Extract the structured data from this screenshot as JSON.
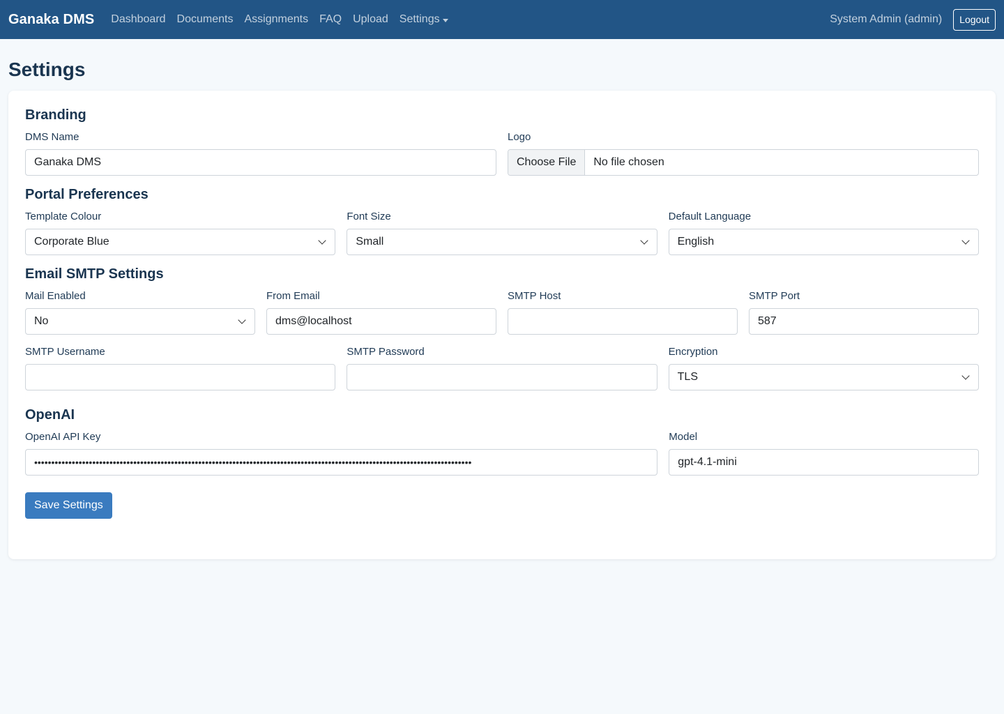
{
  "navbar": {
    "brand": "Ganaka DMS",
    "links": [
      "Dashboard",
      "Documents",
      "Assignments",
      "FAQ",
      "Upload"
    ],
    "settings_label": "Settings",
    "user": "System Admin (admin)",
    "logout": "Logout"
  },
  "page": {
    "title": "Settings"
  },
  "branding": {
    "title": "Branding",
    "dms_name_label": "DMS Name",
    "dms_name_value": "Ganaka DMS",
    "logo_label": "Logo",
    "choose_file": "Choose File",
    "no_file": "No file chosen"
  },
  "portal": {
    "title": "Portal Preferences",
    "template_label": "Template Colour",
    "template_value": "Corporate Blue",
    "font_label": "Font Size",
    "font_value": "Small",
    "lang_label": "Default Language",
    "lang_value": "English"
  },
  "smtp": {
    "title": "Email SMTP Settings",
    "mail_enabled_label": "Mail Enabled",
    "mail_enabled_value": "No",
    "from_label": "From Email",
    "from_value": "dms@localhost",
    "host_label": "SMTP Host",
    "host_value": "",
    "port_label": "SMTP Port",
    "port_value": "587",
    "username_label": "SMTP Username",
    "username_value": "",
    "password_label": "SMTP Password",
    "password_value": "",
    "encryption_label": "Encryption",
    "encryption_value": "TLS"
  },
  "openai": {
    "title": "OpenAI",
    "key_label": "OpenAI API Key",
    "key_masked": "••••••••••••••••••••••••••••••••••••••••••••••••••••••••••••••••••••••••••••••••••••••••••••••••••••••••••••••••••••••••••••••••",
    "model_label": "Model",
    "model_value": "gpt-4.1-mini"
  },
  "actions": {
    "save": "Save Settings"
  },
  "colors": {
    "navbar": "#225586",
    "primary": "#3a7bbf",
    "heading": "#1a3550"
  }
}
